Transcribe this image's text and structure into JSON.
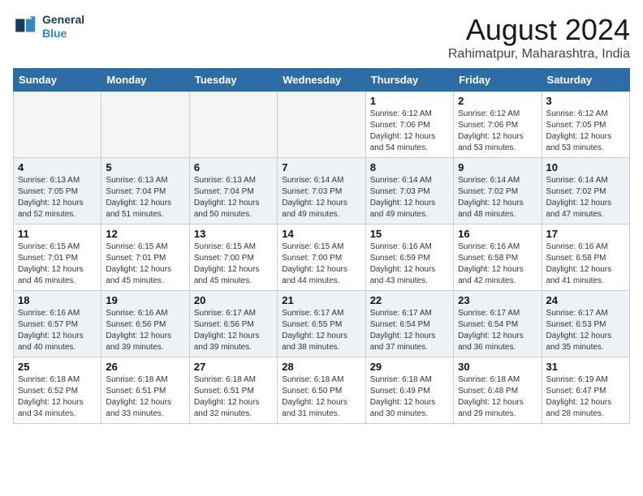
{
  "header": {
    "logo_line1": "General",
    "logo_line2": "Blue",
    "month_year": "August 2024",
    "location": "Rahimatpur, Maharashtra, India"
  },
  "days_of_week": [
    "Sunday",
    "Monday",
    "Tuesday",
    "Wednesday",
    "Thursday",
    "Friday",
    "Saturday"
  ],
  "weeks": [
    [
      {
        "day": "",
        "info": ""
      },
      {
        "day": "",
        "info": ""
      },
      {
        "day": "",
        "info": ""
      },
      {
        "day": "",
        "info": ""
      },
      {
        "day": "1",
        "info": "Sunrise: 6:12 AM\nSunset: 7:06 PM\nDaylight: 12 hours\nand 54 minutes."
      },
      {
        "day": "2",
        "info": "Sunrise: 6:12 AM\nSunset: 7:06 PM\nDaylight: 12 hours\nand 53 minutes."
      },
      {
        "day": "3",
        "info": "Sunrise: 6:12 AM\nSunset: 7:05 PM\nDaylight: 12 hours\nand 53 minutes."
      }
    ],
    [
      {
        "day": "4",
        "info": "Sunrise: 6:13 AM\nSunset: 7:05 PM\nDaylight: 12 hours\nand 52 minutes."
      },
      {
        "day": "5",
        "info": "Sunrise: 6:13 AM\nSunset: 7:04 PM\nDaylight: 12 hours\nand 51 minutes."
      },
      {
        "day": "6",
        "info": "Sunrise: 6:13 AM\nSunset: 7:04 PM\nDaylight: 12 hours\nand 50 minutes."
      },
      {
        "day": "7",
        "info": "Sunrise: 6:14 AM\nSunset: 7:03 PM\nDaylight: 12 hours\nand 49 minutes."
      },
      {
        "day": "8",
        "info": "Sunrise: 6:14 AM\nSunset: 7:03 PM\nDaylight: 12 hours\nand 49 minutes."
      },
      {
        "day": "9",
        "info": "Sunrise: 6:14 AM\nSunset: 7:02 PM\nDaylight: 12 hours\nand 48 minutes."
      },
      {
        "day": "10",
        "info": "Sunrise: 6:14 AM\nSunset: 7:02 PM\nDaylight: 12 hours\nand 47 minutes."
      }
    ],
    [
      {
        "day": "11",
        "info": "Sunrise: 6:15 AM\nSunset: 7:01 PM\nDaylight: 12 hours\nand 46 minutes."
      },
      {
        "day": "12",
        "info": "Sunrise: 6:15 AM\nSunset: 7:01 PM\nDaylight: 12 hours\nand 45 minutes."
      },
      {
        "day": "13",
        "info": "Sunrise: 6:15 AM\nSunset: 7:00 PM\nDaylight: 12 hours\nand 45 minutes."
      },
      {
        "day": "14",
        "info": "Sunrise: 6:15 AM\nSunset: 7:00 PM\nDaylight: 12 hours\nand 44 minutes."
      },
      {
        "day": "15",
        "info": "Sunrise: 6:16 AM\nSunset: 6:59 PM\nDaylight: 12 hours\nand 43 minutes."
      },
      {
        "day": "16",
        "info": "Sunrise: 6:16 AM\nSunset: 6:58 PM\nDaylight: 12 hours\nand 42 minutes."
      },
      {
        "day": "17",
        "info": "Sunrise: 6:16 AM\nSunset: 6:58 PM\nDaylight: 12 hours\nand 41 minutes."
      }
    ],
    [
      {
        "day": "18",
        "info": "Sunrise: 6:16 AM\nSunset: 6:57 PM\nDaylight: 12 hours\nand 40 minutes."
      },
      {
        "day": "19",
        "info": "Sunrise: 6:16 AM\nSunset: 6:56 PM\nDaylight: 12 hours\nand 39 minutes."
      },
      {
        "day": "20",
        "info": "Sunrise: 6:17 AM\nSunset: 6:56 PM\nDaylight: 12 hours\nand 39 minutes."
      },
      {
        "day": "21",
        "info": "Sunrise: 6:17 AM\nSunset: 6:55 PM\nDaylight: 12 hours\nand 38 minutes."
      },
      {
        "day": "22",
        "info": "Sunrise: 6:17 AM\nSunset: 6:54 PM\nDaylight: 12 hours\nand 37 minutes."
      },
      {
        "day": "23",
        "info": "Sunrise: 6:17 AM\nSunset: 6:54 PM\nDaylight: 12 hours\nand 36 minutes."
      },
      {
        "day": "24",
        "info": "Sunrise: 6:17 AM\nSunset: 6:53 PM\nDaylight: 12 hours\nand 35 minutes."
      }
    ],
    [
      {
        "day": "25",
        "info": "Sunrise: 6:18 AM\nSunset: 6:52 PM\nDaylight: 12 hours\nand 34 minutes."
      },
      {
        "day": "26",
        "info": "Sunrise: 6:18 AM\nSunset: 6:51 PM\nDaylight: 12 hours\nand 33 minutes."
      },
      {
        "day": "27",
        "info": "Sunrise: 6:18 AM\nSunset: 6:51 PM\nDaylight: 12 hours\nand 32 minutes."
      },
      {
        "day": "28",
        "info": "Sunrise: 6:18 AM\nSunset: 6:50 PM\nDaylight: 12 hours\nand 31 minutes."
      },
      {
        "day": "29",
        "info": "Sunrise: 6:18 AM\nSunset: 6:49 PM\nDaylight: 12 hours\nand 30 minutes."
      },
      {
        "day": "30",
        "info": "Sunrise: 6:18 AM\nSunset: 6:48 PM\nDaylight: 12 hours\nand 29 minutes."
      },
      {
        "day": "31",
        "info": "Sunrise: 6:19 AM\nSunset: 6:47 PM\nDaylight: 12 hours\nand 28 minutes."
      }
    ]
  ]
}
